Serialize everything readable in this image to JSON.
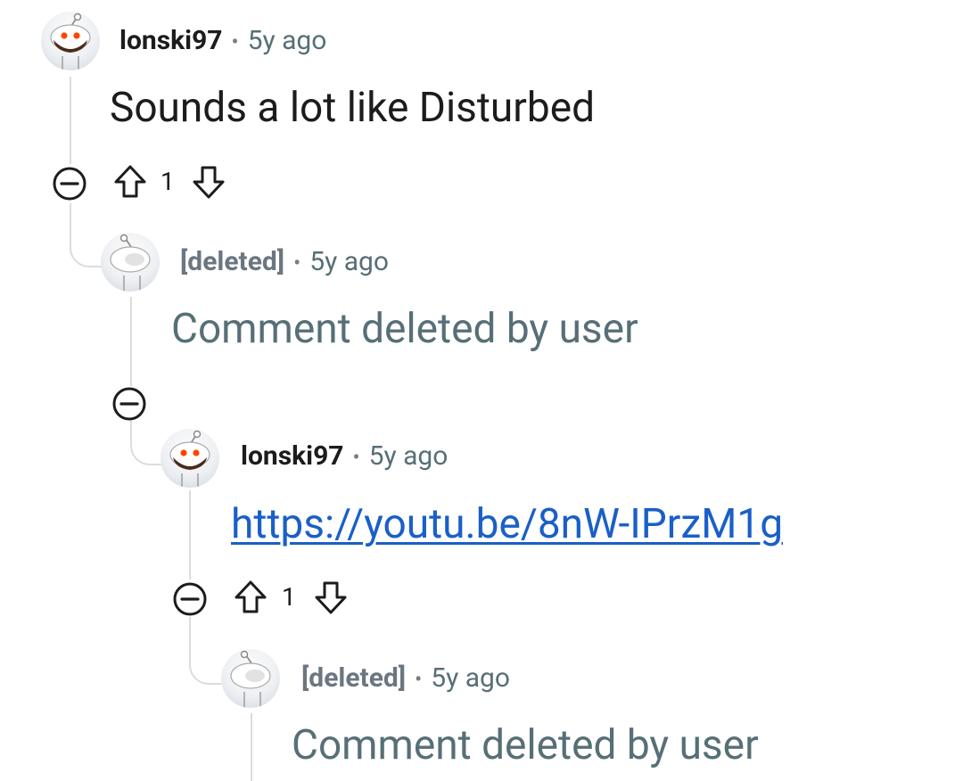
{
  "comments": [
    {
      "author": "lonski97",
      "separator": "•",
      "time": "5y ago",
      "body": "Sounds a lot like Disturbed",
      "score": "1"
    },
    {
      "author": "[deleted]",
      "separator": "•",
      "time": "5y ago",
      "body": "Comment deleted by user"
    },
    {
      "author": "lonski97",
      "separator": "•",
      "time": "5y ago",
      "body": "https://youtu.be/8nW-IPrzM1g",
      "score": "1"
    },
    {
      "author": "[deleted]",
      "separator": "•",
      "time": "5y ago",
      "body": "Comment deleted by user"
    }
  ],
  "icons": {
    "collapse": "minus-circle-icon",
    "upvote": "arrow-up-outline-icon",
    "downvote": "arrow-down-outline-icon",
    "avatar": "snoo-avatar"
  },
  "colors": {
    "link": "#1a5fc8",
    "meta_time": "#576f76",
    "thread_line": "#dcdcdc",
    "snoo_eye": "#ff4500"
  }
}
